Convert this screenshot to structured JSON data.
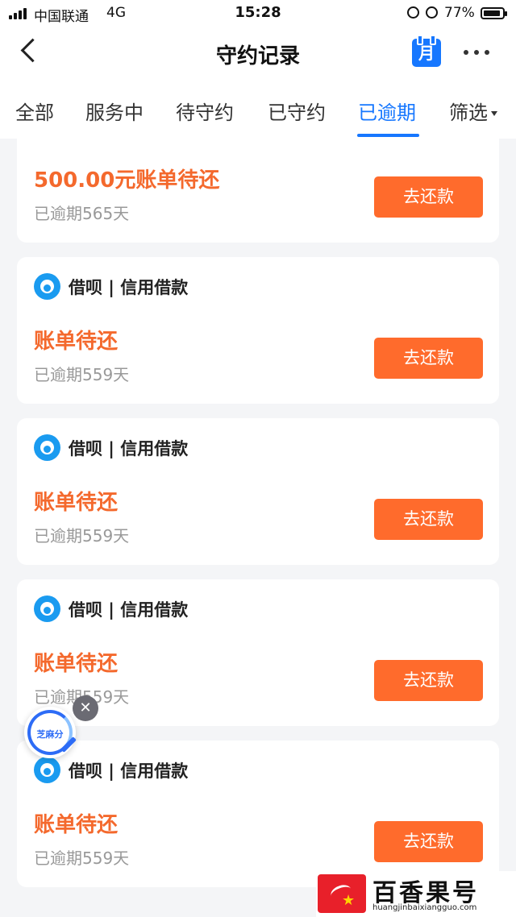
{
  "status_bar": {
    "carrier": "中国联通",
    "network": "4G",
    "time": "15:28",
    "battery": "77%"
  },
  "nav": {
    "title": "守约记录",
    "calendar_label": "月"
  },
  "tabs": [
    {
      "label": "全部"
    },
    {
      "label": "服务中"
    },
    {
      "label": "待守约"
    },
    {
      "label": "已守约"
    },
    {
      "label": "已逾期",
      "active": true
    },
    {
      "label": "筛选"
    }
  ],
  "cards": [
    {
      "provider": "",
      "bill": "500.00元账单待还",
      "overdue": "已逾期565天",
      "button": "去还款"
    },
    {
      "provider": "借呗 | 信用借款",
      "bill": "账单待还",
      "overdue": "已逾期559天",
      "button": "去还款"
    },
    {
      "provider": "借呗 | 信用借款",
      "bill": "账单待还",
      "overdue": "已逾期559天",
      "button": "去还款"
    },
    {
      "provider": "借呗 | 信用借款",
      "bill": "账单待还",
      "overdue": "已逾期559天",
      "button": "去还款"
    },
    {
      "provider": "借呗 | 信用借款",
      "bill": "账单待还",
      "overdue": "已逾期559天",
      "button": "去还款"
    }
  ],
  "floating_badge": {
    "label": "芝麻分"
  },
  "watermark": {
    "name": "百香果号",
    "url": "huangjinbaixiangguo.com"
  },
  "colors": {
    "accent_blue": "#1677ff",
    "action_orange": "#ff6b2c",
    "bill_orange": "#f4692d"
  }
}
